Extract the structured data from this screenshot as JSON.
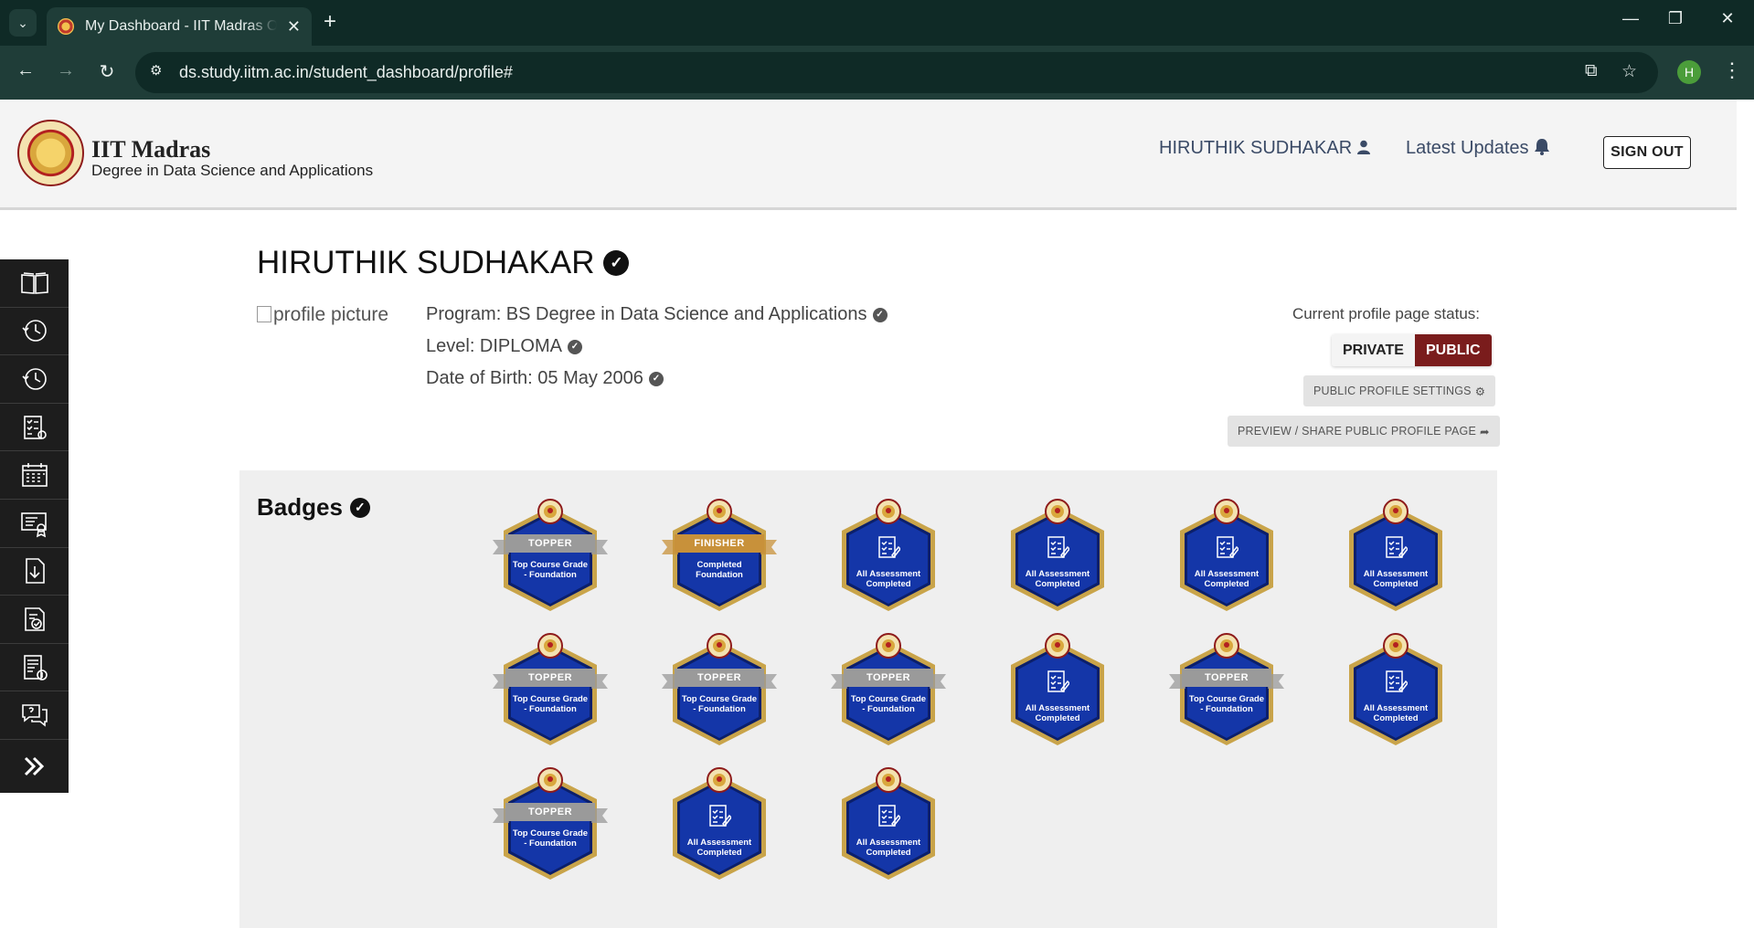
{
  "browser": {
    "tab_title": "My Dashboard - IIT Madras Online Degree",
    "url": "ds.study.iitm.ac.in/student_dashboard/profile#",
    "profile_initial": "H"
  },
  "header": {
    "brand_title": "IIT Madras",
    "brand_subtitle": "Degree in Data Science and Applications",
    "user_name": "HIRUTHIK SUDHAKAR",
    "updates_label": "Latest Updates",
    "sign_out_label": "SIGN OUT"
  },
  "sidebar": {
    "items": [
      "book-icon",
      "history-icon",
      "history-icon-2",
      "assignment-icon",
      "calendar-icon",
      "certificate-icon",
      "download-icon",
      "checklist-icon",
      "payment-icon",
      "support-chat-icon",
      "expand-icon"
    ]
  },
  "profile": {
    "name": "HIRUTHIK SUDHAKAR",
    "picture_alt": "profile picture",
    "program": "Program: BS Degree in Data Science and Applications",
    "level": "Level: DIPLOMA",
    "dob": "Date of Birth: 05 May 2006",
    "status_label": "Current profile page status:",
    "private_label": "PRIVATE",
    "public_label": "PUBLIC",
    "settings_label": "PUBLIC PROFILE SETTINGS",
    "share_label": "PREVIEW / SHARE PUBLIC PROFILE PAGE"
  },
  "badges": {
    "title": "Badges",
    "items": [
      {
        "kind": "topper",
        "ribbon": "TOPPER",
        "line1": "Top Course Grade",
        "line2": "- Foundation"
      },
      {
        "kind": "finisher",
        "ribbon": "FINISHER",
        "line1": "Completed",
        "line2": "Foundation"
      },
      {
        "kind": "assessment",
        "line1": "All Assessment",
        "line2": "Completed"
      },
      {
        "kind": "assessment",
        "line1": "All Assessment",
        "line2": "Completed"
      },
      {
        "kind": "assessment",
        "line1": "All Assessment",
        "line2": "Completed"
      },
      {
        "kind": "assessment",
        "line1": "All Assessment",
        "line2": "Completed"
      },
      {
        "kind": "topper",
        "ribbon": "TOPPER",
        "line1": "Top Course Grade",
        "line2": "- Foundation"
      },
      {
        "kind": "topper",
        "ribbon": "TOPPER",
        "line1": "Top Course Grade",
        "line2": "- Foundation"
      },
      {
        "kind": "topper",
        "ribbon": "TOPPER",
        "line1": "Top Course Grade",
        "line2": "- Foundation"
      },
      {
        "kind": "assessment",
        "line1": "All Assessment",
        "line2": "Completed"
      },
      {
        "kind": "topper",
        "ribbon": "TOPPER",
        "line1": "Top Course Grade",
        "line2": "- Foundation"
      },
      {
        "kind": "assessment",
        "line1": "All Assessment",
        "line2": "Completed"
      },
      {
        "kind": "topper",
        "ribbon": "TOPPER",
        "line1": "Top Course Grade",
        "line2": "- Foundation"
      },
      {
        "kind": "assessment",
        "line1": "All Assessment",
        "line2": "Completed"
      },
      {
        "kind": "assessment",
        "line1": "All Assessment",
        "line2": "Completed"
      }
    ]
  },
  "colors": {
    "badge_blue": "#1436a8",
    "badge_border": "#c9a44a",
    "topper_ribbon": "#9a9a9a",
    "finisher_ribbon": "#c8913a",
    "public_active": "#7a1c1c"
  }
}
